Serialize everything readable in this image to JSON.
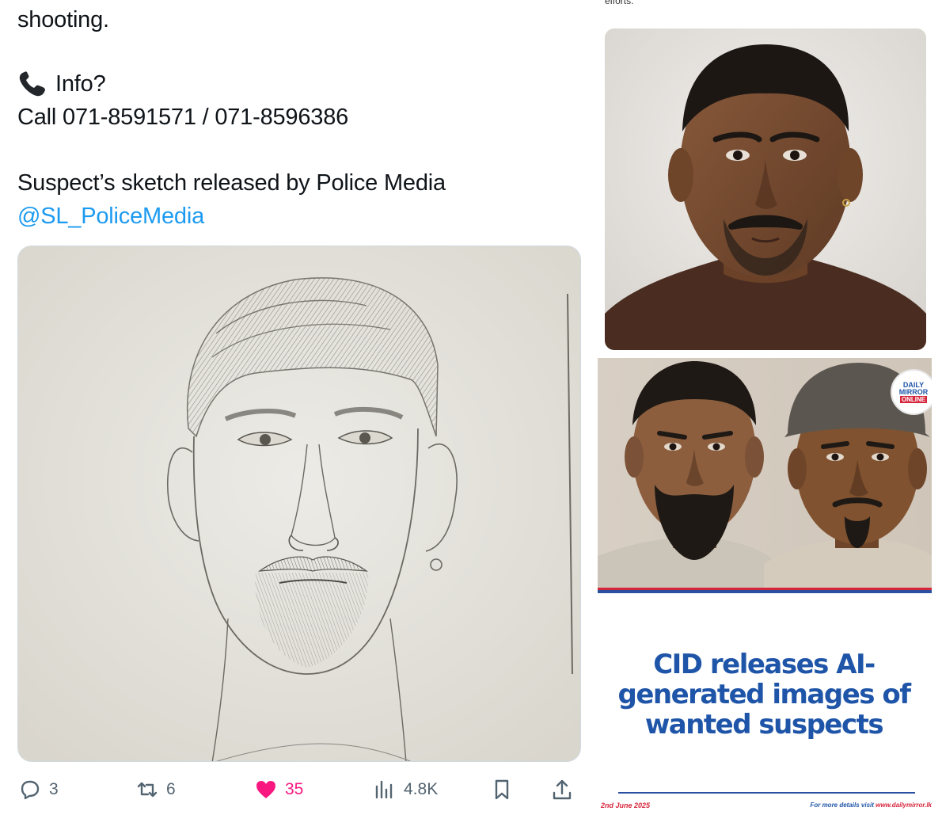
{
  "tweet": {
    "lines": {
      "shooting": "shooting.",
      "info": "Info?",
      "call": "Call 071-8591571 / 071-8596386",
      "sketch": "Suspect’s sketch released by Police Media",
      "handle": "@SL_PoliceMedia"
    },
    "media_alt_icon": "pencil-sketch-portrait",
    "actions": {
      "replies": "3",
      "reposts": "6",
      "likes": "35",
      "views": "4.8K"
    },
    "colors": {
      "link": "#1d9bf0",
      "like": "#f91880",
      "muted": "#536471"
    }
  },
  "right": {
    "top_fragment": "efforts.",
    "news": {
      "logo_line1": "DAILY",
      "logo_line2": "MIRROR",
      "logo_line3": "ONLINE",
      "headline": "CID releases AI-generated images of wanted suspects",
      "date": "2nd June 2025",
      "more_prefix": "For more details visit ",
      "more_url": "www.dailymirror.lk",
      "colors": {
        "blue": "#1f55a8",
        "red": "#d6243b"
      }
    }
  }
}
